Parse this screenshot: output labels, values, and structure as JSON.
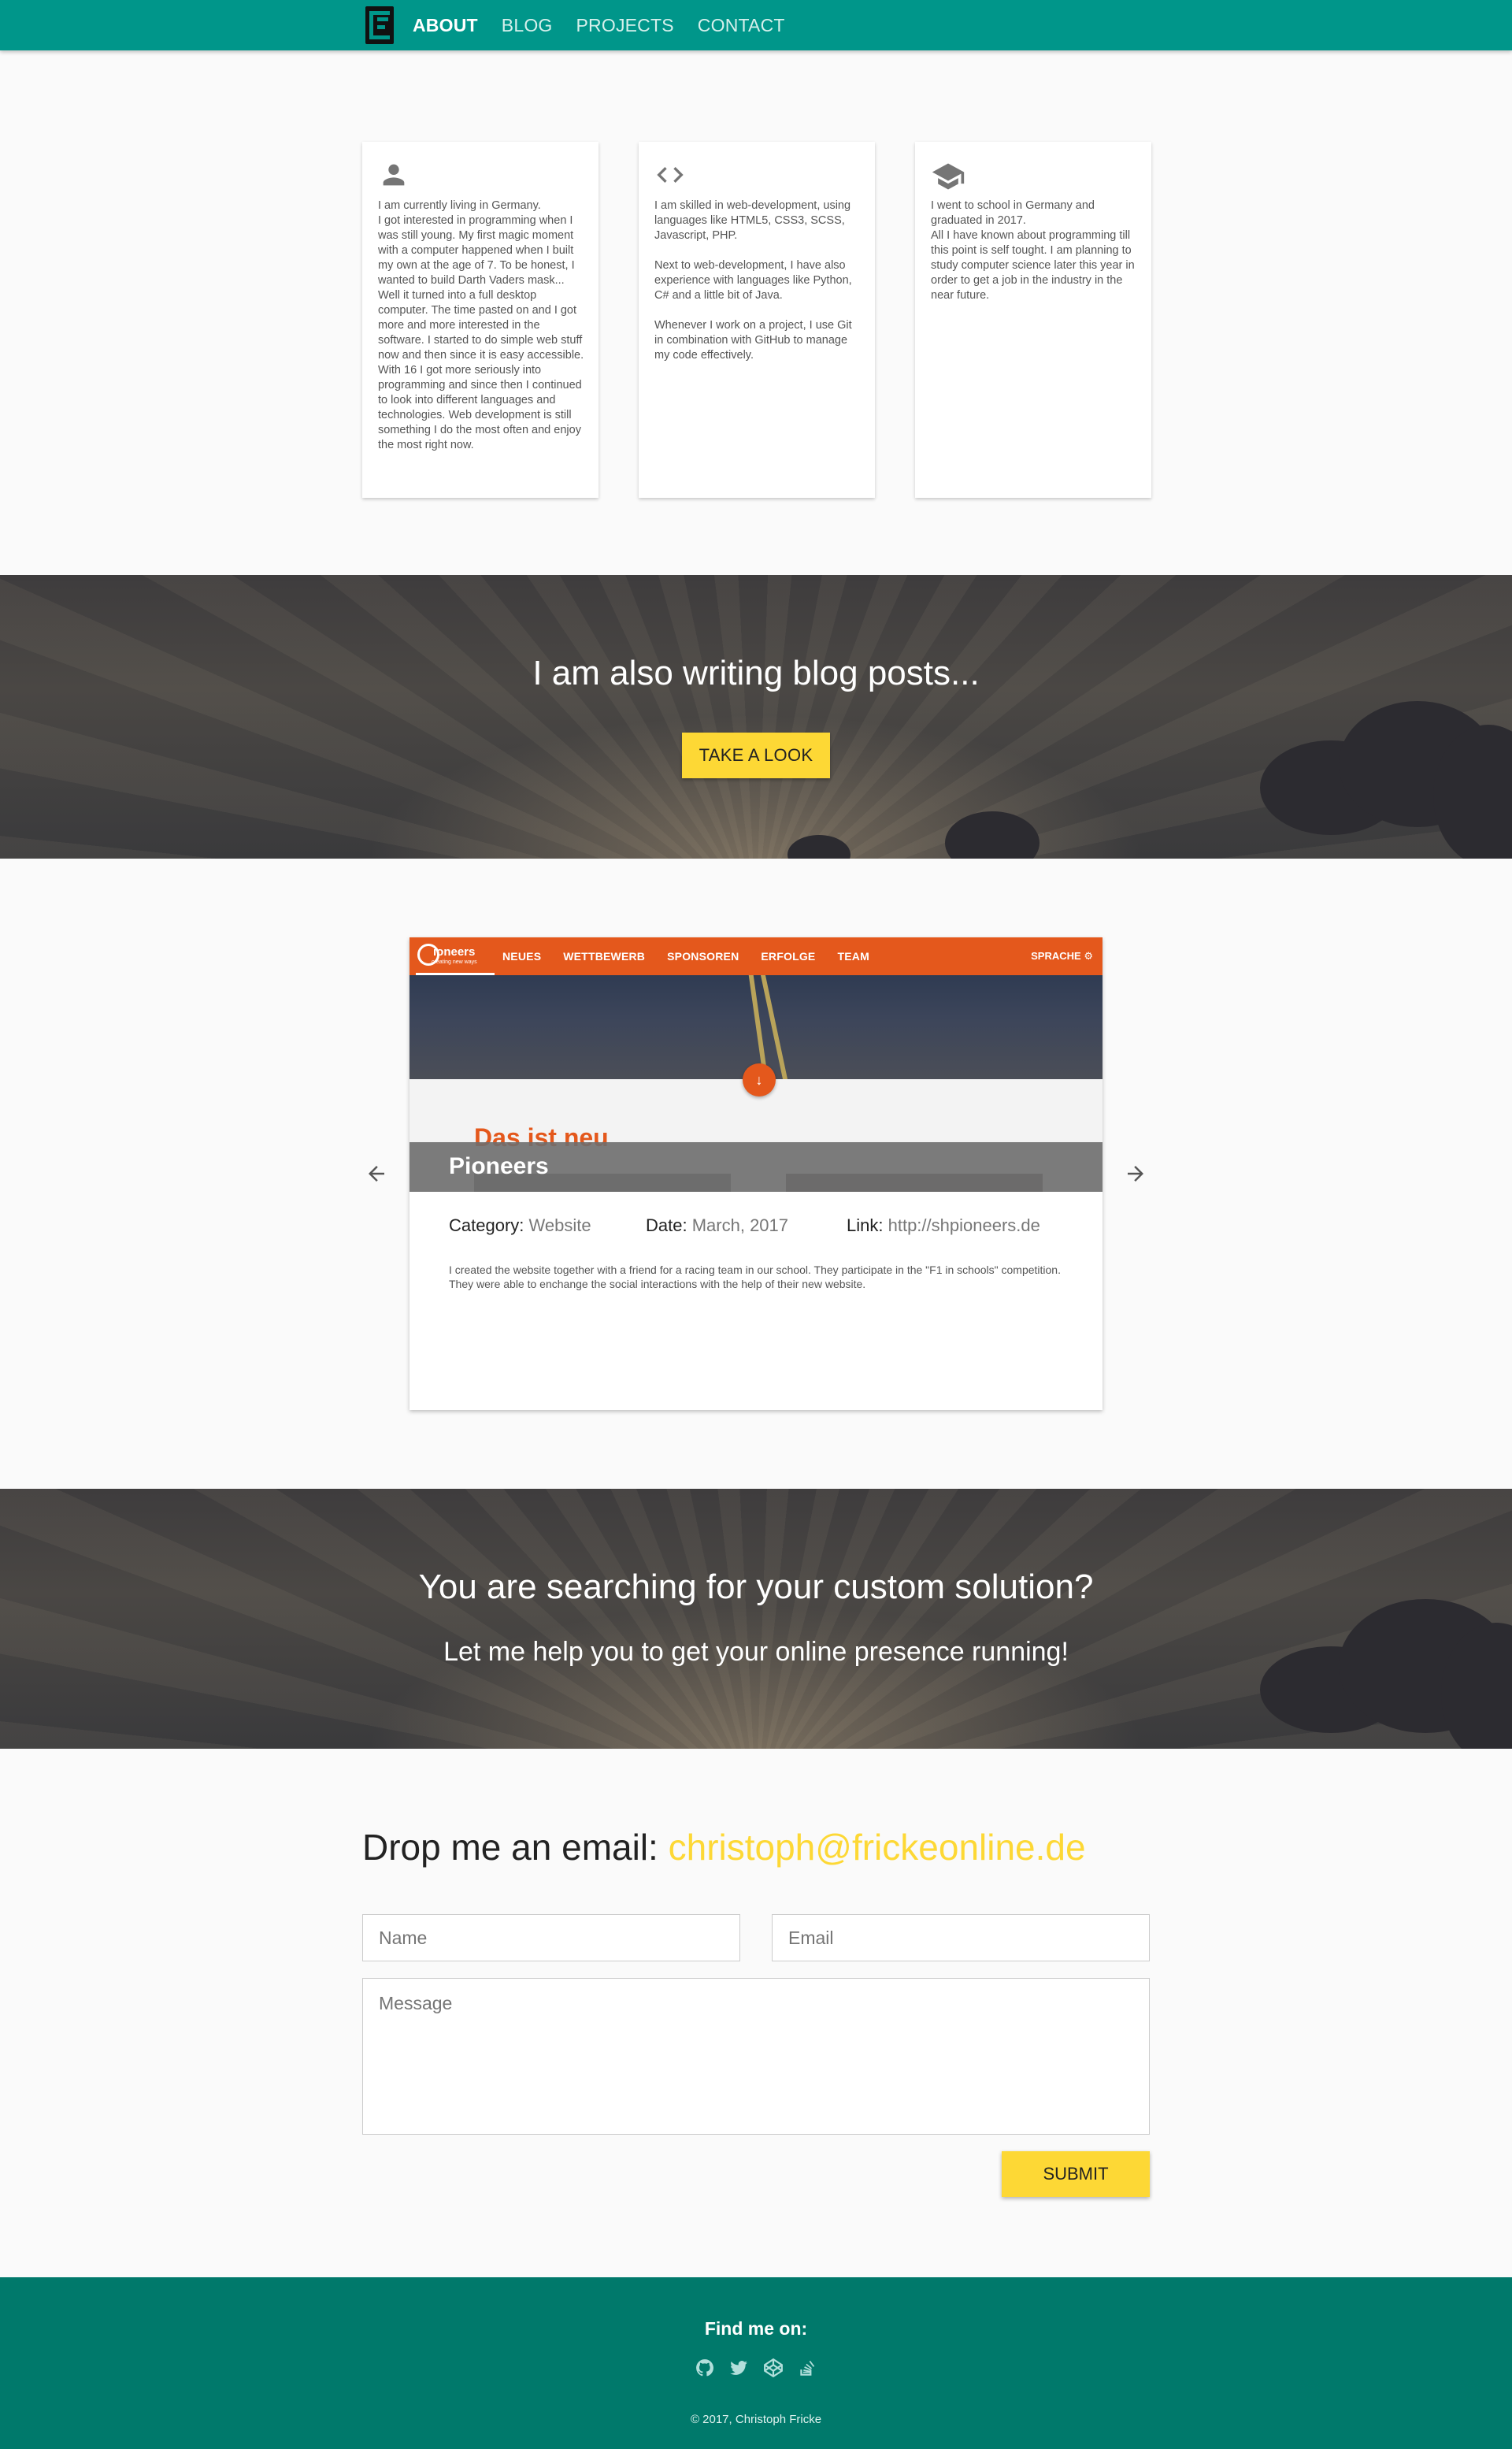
{
  "nav": {
    "items": [
      {
        "label": "ABOUT"
      },
      {
        "label": "BLOG"
      },
      {
        "label": "PROJECTS"
      },
      {
        "label": "CONTACT"
      }
    ]
  },
  "about": {
    "cards": [
      {
        "icon": "person-icon",
        "text": "I am currently living in Germany.\nI got interested in programming when I was still young. My first magic moment with a computer happened when I built my own at the age of 7. To be honest, I wanted to build Darth Vaders mask... Well it turned into a full desktop computer. The time pasted on and I got more and more interested in the software. I started to do simple web stuff now and then since it is easy accessible. With 16 I got more seriously into programming and since then I continued to look into different languages and technologies. Web development is still something I do the most often and enjoy the most right now."
      },
      {
        "icon": "code-icon",
        "text": "I am skilled in web-development, using languages like HTML5, CSS3, SCSS, Javascript, PHP.\n\nNext to web-development, I have also experience with languages like Python, C# and a little bit of Java.\n\nWhenever I work on a project, I use Git in combination with GitHub to manage my code effectively."
      },
      {
        "icon": "graduation-cap-icon",
        "text": "I went to school in Germany and graduated in 2017.\nAll I have known about programming till this point is self tought. I am planning to study computer science later this year in order to get a job in the industry in the near future."
      }
    ]
  },
  "blog_banner": {
    "title": "I am also writing blog posts...",
    "button": "TAKE A LOOK"
  },
  "project": {
    "screenshot": {
      "logo": "ioneers",
      "logo_sub": "creating new ways",
      "menu": [
        "NEUES",
        "WETTBEWERB",
        "SPONSOREN",
        "ERFOLGE",
        "TEAM"
      ],
      "lang": "SPRACHE",
      "heading": "Das ist neu"
    },
    "name": "Pioneers",
    "category_label": "Category:",
    "category": "Website",
    "date_label": "Date:",
    "date": "March, 2017",
    "link_label": "Link:",
    "link": "http://shpioneers.de",
    "description": "I created the website together with a friend for a racing team in our school. They participate in the \"F1 in schools\" competition. They were able to enchange the social interactions with the help of their new website."
  },
  "solution_banner": {
    "title": "You are searching for your custom solution?",
    "subtitle": "Let me help you to get your online presence running!"
  },
  "contact": {
    "title": "Drop me an email:",
    "email": "christoph@frickeonline.de",
    "name_placeholder": "Name",
    "email_placeholder": "Email",
    "message_placeholder": "Message",
    "submit": "SUBMIT"
  },
  "footer": {
    "find_label": "Find me on:",
    "socials": [
      "github-icon",
      "twitter-icon",
      "codepen-icon",
      "stackoverflow-icon"
    ],
    "copyright": "© 2017, Christoph Fricke"
  },
  "colors": {
    "nav": "#00968a",
    "footer": "#00796b",
    "accent": "#fdd835",
    "project_brand": "#e4581c"
  }
}
